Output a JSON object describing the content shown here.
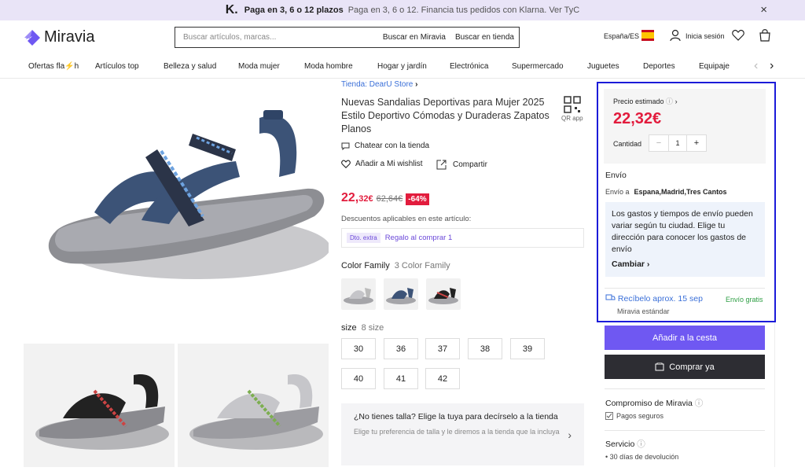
{
  "banner": {
    "logo": "K.",
    "bold": "Paga en 3, 6 o 12 plazos",
    "light": "Paga en 3, 6 o 12. Financia tus pedidos con Klarna. Ver TyC",
    "close": "×"
  },
  "header": {
    "logo": "Miravia",
    "search_placeholder": "Buscar artículos, marcas...",
    "search_miravia": "Buscar en Miravia",
    "search_store": "Buscar en tienda",
    "country": "España/ES",
    "login": "Inicia sesión"
  },
  "nav": {
    "items": [
      "Ofertas fla⚡h",
      "Artículos top",
      "Belleza y salud",
      "Moda mujer",
      "Moda hombre",
      "Hogar y jardín",
      "Electrónica",
      "Supermercado",
      "Juguetes",
      "Deportes",
      "Equipaje"
    ],
    "prev": "‹",
    "next": "›"
  },
  "product": {
    "store": "Tienda: DearU Store",
    "title": "Nuevas Sandalias Deportivas para Mujer 2025 Estilo Deportivo Cómodas y Duraderas Zapatos Planos",
    "qr": "QR app",
    "chat": "Chatear con la tienda",
    "wishlist": "Añadir a Mi wishlist",
    "share": "Compartir",
    "price_main": "22,",
    "price_dec": "32€",
    "price_old": "62,64€",
    "discount": "-64%",
    "discounts_label": "Descuentos aplicables en este artículo:",
    "discount_tag": "Dto. extra",
    "discount_text": "Regalo al comprar 1",
    "color_label": "Color Family",
    "color_sub": "3 Color Family",
    "size_label": "size",
    "size_sub": "8 size",
    "sizes": [
      "30",
      "36",
      "37",
      "38",
      "39",
      "40",
      "41",
      "42"
    ],
    "size_help_title": "¿No tienes talla? Elige la tuya para decírselo a la tienda",
    "size_help_desc": "Elige tu preferencia de talla y le diremos a la tienda que la incluya"
  },
  "buy": {
    "price_label": "Precio estimado",
    "price": "22,32€",
    "qty_label": "Cantidad",
    "qty": "1",
    "minus": "−",
    "plus": "+",
    "shipping": "Envío",
    "ship_to_label": "Envío a",
    "ship_to": "Espana,Madrid,Tres Cantos",
    "info": "Los gastos y tiempos de envío pueden variar según tu ciudad. Elige tu dirección para conocer los gastos de envío",
    "change": "Cambiar",
    "receive": "Recíbelo aprox. 15 sep",
    "free": "Envío gratis",
    "standard": "Miravia estándar",
    "add_cart": "Añadir a la cesta",
    "buy_now": "Comprar ya",
    "commitment": "Compromiso de Miravia",
    "secure": "Pagos seguros",
    "service": "Servicio",
    "returns": "• 30 días de devolución"
  },
  "colors": {
    "accent": "#6f58f2",
    "price": "#e21c3d",
    "dark_button": "#2d2d33",
    "highlight_border": "#1b1bd9"
  }
}
